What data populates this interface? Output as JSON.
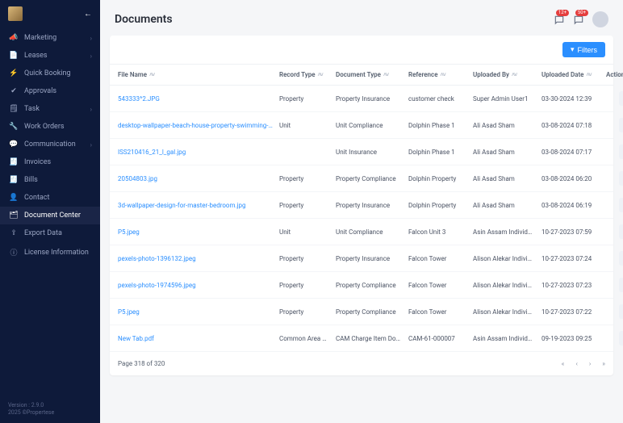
{
  "sidebar": {
    "items": [
      {
        "icon": "📣",
        "label": "Marketing",
        "chev": true
      },
      {
        "icon": "📄",
        "label": "Leases",
        "chev": true
      },
      {
        "icon": "⚡",
        "label": "Quick Booking",
        "chev": false
      },
      {
        "icon": "✔",
        "label": "Approvals",
        "chev": false
      },
      {
        "icon": "🗒",
        "label": "Task",
        "chev": true
      },
      {
        "icon": "🔧",
        "label": "Work Orders",
        "chev": false
      },
      {
        "icon": "💬",
        "label": "Communication",
        "chev": true
      },
      {
        "icon": "🧾",
        "label": "Invoices",
        "chev": false
      },
      {
        "icon": "🧾",
        "label": "Bills",
        "chev": false
      },
      {
        "icon": "👤",
        "label": "Contact",
        "chev": false
      },
      {
        "icon": "🗂",
        "label": "Document Center",
        "chev": false,
        "active": true
      },
      {
        "icon": "⇪",
        "label": "Export Data",
        "chev": false
      },
      {
        "icon": "ⓘ",
        "label": "License Information",
        "chev": false
      }
    ],
    "version": "Version : 2.9.0",
    "copyright": "2025 ©Propertese"
  },
  "header": {
    "title": "Documents",
    "notif1_badge": "12+",
    "notif2_badge": "50+"
  },
  "toolbar": {
    "filters": "Filters"
  },
  "table": {
    "columns": [
      "File Name",
      "Record Type",
      "Document Type",
      "Reference",
      "Uploaded By",
      "Uploaded Date",
      "Actions"
    ],
    "rows": [
      {
        "file": "543333^2.JPG",
        "record": "Property",
        "doc": "Property Insurance",
        "ref": "customer check",
        "by": "Super Admin User1",
        "date": "03-30-2024 12:39"
      },
      {
        "file": "desktop-wallpaper-beach-house-property-swimming-pool-house-hom…",
        "record": "Unit",
        "doc": "Unit Compliance",
        "ref": "Dolphin Phase 1",
        "by": "Ali Asad Sham",
        "date": "03-08-2024 07:18"
      },
      {
        "file": "ISS210416_21_l_gal.jpg",
        "record": "",
        "doc": "Unit Insurance",
        "ref": "Dolphin Phase 1",
        "by": "Ali Asad Sham",
        "date": "03-08-2024 07:17"
      },
      {
        "file": "20504803.jpg",
        "record": "Property",
        "doc": "Property Compliance",
        "ref": "Dolphin Property",
        "by": "Ali Asad Sham",
        "date": "03-08-2024 06:20"
      },
      {
        "file": "3d-wallpaper-design-for-master-bedroom.jpg",
        "record": "Property",
        "doc": "Property Insurance",
        "ref": "Dolphin Property",
        "by": "Ali Asad Sham",
        "date": "03-08-2024 06:19"
      },
      {
        "file": "P5.jpeg",
        "record": "Unit",
        "doc": "Unit Compliance",
        "ref": "Falcon Unit 3",
        "by": "Asin Assam Individ…",
        "date": "10-27-2023 07:59"
      },
      {
        "file": "pexels-photo-1396132.jpeg",
        "record": "Property",
        "doc": "Property Insurance",
        "ref": "Falcon Tower",
        "by": "Alison Alekar Indivi…",
        "date": "10-27-2023 07:24"
      },
      {
        "file": "pexels-photo-1974596.jpeg",
        "record": "Property",
        "doc": "Property Compliance",
        "ref": "Falcon Tower",
        "by": "Alison Alekar Indivi…",
        "date": "10-27-2023 07:23"
      },
      {
        "file": "P5.jpeg",
        "record": "Property",
        "doc": "Property Compliance",
        "ref": "Falcon Tower",
        "by": "Alison Alekar Indivi…",
        "date": "10-27-2023 07:22"
      },
      {
        "file": "New Tab.pdf",
        "record": "Common Area Maint…",
        "doc": "CAM Charge Item Do…",
        "ref": "CAM-61-000007",
        "by": "Asin Assam Individ…",
        "date": "09-19-2023 09:25"
      }
    ]
  },
  "pager": {
    "info": "Page 318 of 320"
  }
}
